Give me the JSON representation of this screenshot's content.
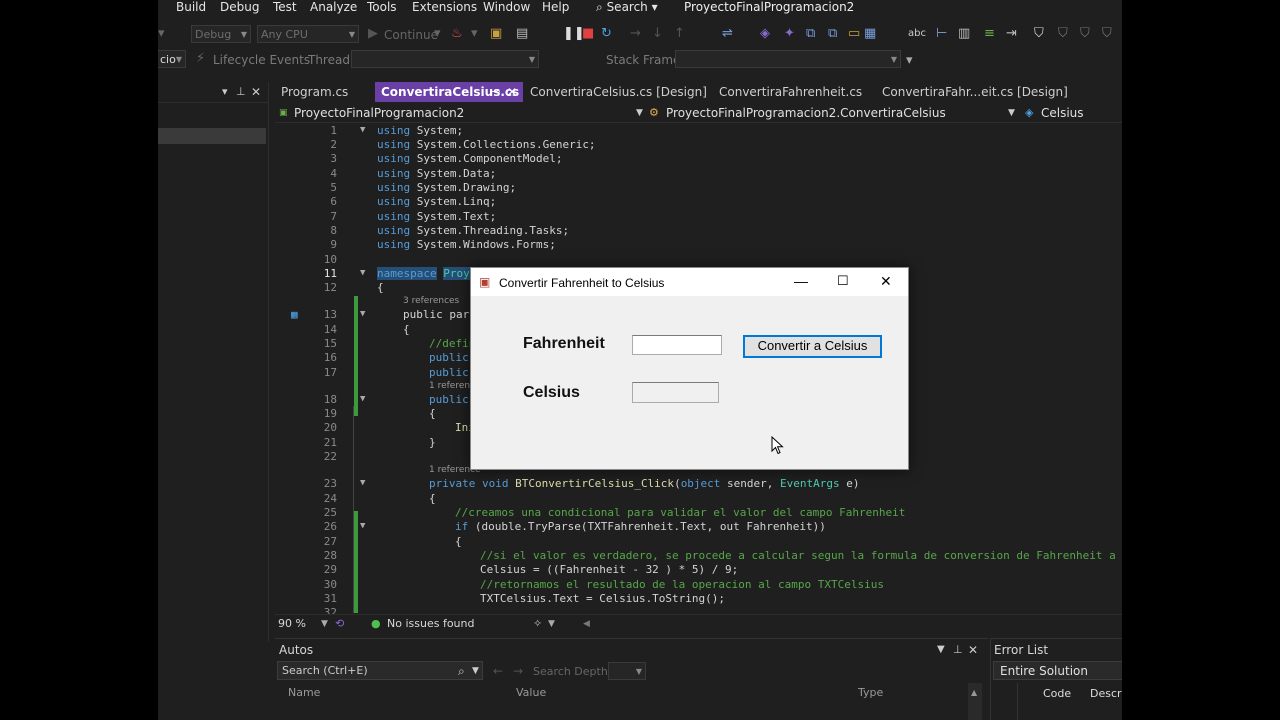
{
  "menu": [
    "Build",
    "Debug",
    "Test",
    "Analyze",
    "Tools",
    "Extensions",
    "Window",
    "Help"
  ],
  "search_label": "Search",
  "project_title": "ProyectoFinalProgramacion2",
  "toolbar": {
    "config": "Debug",
    "platform": "Any CPU",
    "continue_label": "Continue",
    "stack_frame_label": "Stack Frame:",
    "left_combo": "cio",
    "lifecycle_label": "Lifecycle Events",
    "thread_label": "Thread:"
  },
  "tabs": [
    {
      "label": "Program.cs"
    },
    {
      "label": "ConvertiraCelsius.cs"
    },
    {
      "label": "ConvertiraCelsius.cs [Design]"
    },
    {
      "label": "ConvertiraFahrenheit.cs"
    },
    {
      "label": "ConvertiraFahr...eit.cs [Design]"
    }
  ],
  "navbar": {
    "project": "ProyectoFinalProgramacion2",
    "class": "ProyectoFinalProgramacion2.ConvertiraCelsius",
    "member": "Celsius"
  },
  "code": {
    "line_numbers": [
      "1",
      "2",
      "3",
      "4",
      "5",
      "6",
      "7",
      "8",
      "9",
      "10",
      "11",
      "12",
      "13",
      "14",
      "15",
      "16",
      "17",
      "18",
      "19",
      "20",
      "21",
      "22",
      "23",
      "24",
      "25",
      "26",
      "27",
      "28",
      "29",
      "30",
      "31",
      "32"
    ],
    "usings": [
      "System;",
      "System.Collections.Generic;",
      "System.ComponentModel;",
      "System.Data;",
      "System.Drawing;",
      "System.Linq;",
      "System.Text;",
      "System.Threading.Tasks;",
      "System.Windows.Forms;"
    ],
    "using_kw": "using",
    "namespace_kw": "namespace",
    "namespace_name": "Proye",
    "brace_open": "{",
    "brace_close": "}",
    "refs3": "3 references",
    "refs1": "1 reference",
    "l13": "public part",
    "l15": "//defin",
    "l16": "public",
    "l17": "public",
    "l18": "public",
    "l20": "Ini",
    "l23_kw": "private void",
    "l23_method": "BTConvertirCelsius_Click",
    "l23_rest1": "(",
    "l23_obj": "object",
    "l23_sender": " sender, ",
    "l23_evt": "EventArgs",
    "l23_rest2": " e)",
    "l25": "//creamos una condicional para validar el valor del campo Fahrenheit",
    "l26_if": "if",
    "l26_rest": " (double.TryParse(TXTFahrenheit.Text, out Fahrenheit))",
    "l28": "//si el valor es verdadero, se procede a calcular segun la formula de conversion de Fahrenheit a Cel",
    "l29": "Celsius = ((Fahrenheit - 32 ) * 5) / 9;",
    "l30": "//retornamos el resultado de la operacion al campo TXTCelsius",
    "l31": "TXTCelsius.Text = Celsius.ToString();"
  },
  "status": {
    "zoom": "90 %",
    "issues": "No issues found"
  },
  "autos": {
    "title": "Autos",
    "search_placeholder": "Search (Ctrl+E)",
    "search_depth": "Search Depth:",
    "col_name": "Name",
    "col_value": "Value",
    "col_type": "Type"
  },
  "errorlist": {
    "title": "Error List",
    "scope": "Entire Solution",
    "col_code": "Code",
    "col_desc": "Descrip"
  },
  "dialog": {
    "title": "Convertir Fahrenheit to Celsius",
    "fahrenheit_label": "Fahrenheit",
    "celsius_label": "Celsius",
    "convert_button": "Convertir a Celsius",
    "fahrenheit_value": "",
    "celsius_value": ""
  },
  "colors": {
    "accent": "#6a3fa6",
    "button_border": "#0078d7",
    "comment": "#57a64a",
    "keyword": "#569cd6"
  }
}
